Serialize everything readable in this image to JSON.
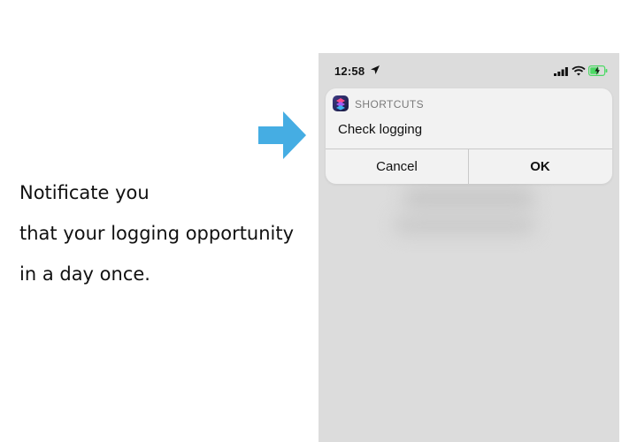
{
  "caption": {
    "line1": "Notificate you",
    "line2": "that your logging opportunity",
    "line3": "in a day once."
  },
  "status_bar": {
    "time": "12:58",
    "icons": [
      "location-arrow-icon",
      "cellular-signal-icon",
      "wifi-icon",
      "battery-charging-icon"
    ]
  },
  "notification": {
    "app_name": "SHORTCUTS",
    "message": "Check logging",
    "cancel_label": "Cancel",
    "ok_label": "OK"
  },
  "colors": {
    "arrow": "#45ADE3",
    "phone_bg": "#dcdcdc",
    "notification_bg": "#f2f2f2",
    "battery_charging": "#4cd964"
  }
}
